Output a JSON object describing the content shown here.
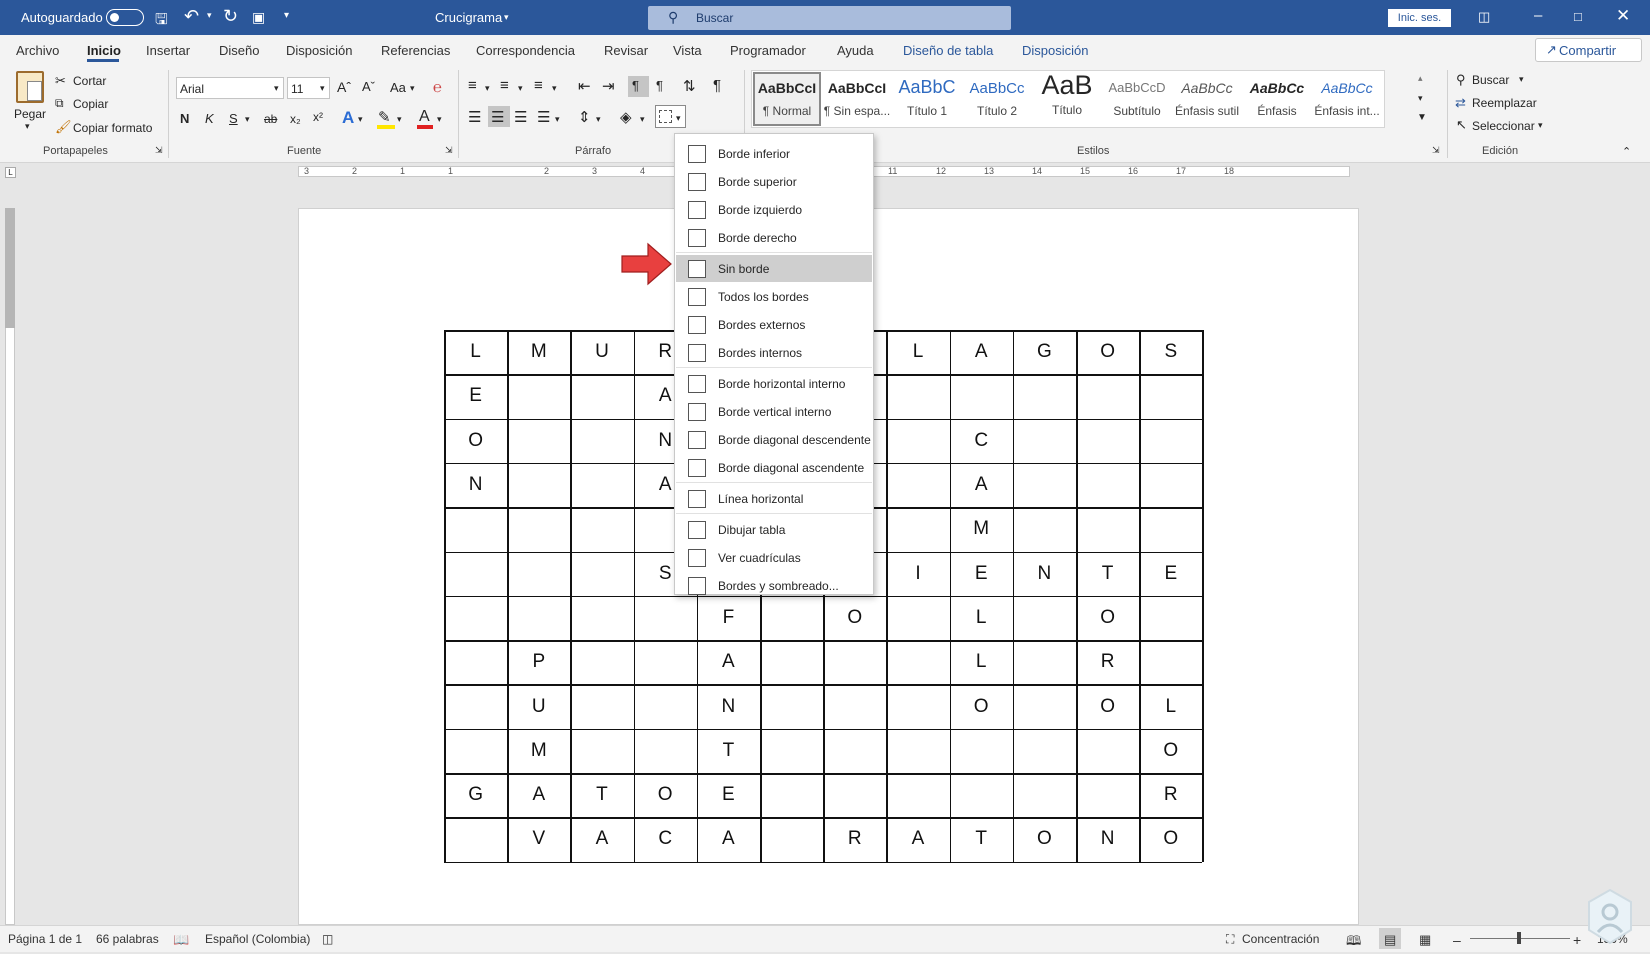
{
  "titlebar": {
    "autosave_label": "Autoguardado",
    "doc_name": "Crucigrama",
    "search_placeholder": "Buscar",
    "signin": "Inic. ses."
  },
  "tabs": [
    "Archivo",
    "Inicio",
    "Insertar",
    "Diseño",
    "Disposición",
    "Referencias",
    "Correspondencia",
    "Revisar",
    "Vista",
    "Programador",
    "Ayuda",
    "Diseño de tabla",
    "Disposición"
  ],
  "share": "Compartir",
  "clipboard": {
    "paste": "Pegar",
    "cut": "Cortar",
    "copy": "Copiar",
    "format_painter": "Copiar formato",
    "group": "Portapapeles"
  },
  "font": {
    "name": "Arial",
    "size": "11",
    "group": "Fuente",
    "bold": "N",
    "italic": "K",
    "underline": "S",
    "strike": "ab",
    "sub": "x₂",
    "sup": "x²",
    "case": "Aa"
  },
  "paragraph": {
    "group": "Párrafo"
  },
  "styles": {
    "group": "Estilos",
    "items": [
      {
        "preview": "AaBbCcI",
        "name": "¶ Normal"
      },
      {
        "preview": "AaBbCcI",
        "name": "¶ Sin espa..."
      },
      {
        "preview": "AaBbC",
        "name": "Título 1"
      },
      {
        "preview": "AaBbCc",
        "name": "Título 2"
      },
      {
        "preview": "AaB",
        "name": "Título"
      },
      {
        "preview": "AaBbCcD",
        "name": "Subtítulo"
      },
      {
        "preview": "AaBbCc",
        "name": "Énfasis sutil"
      },
      {
        "preview": "AaBbCc",
        "name": "Énfasis"
      },
      {
        "preview": "AaBbCc",
        "name": "Énfasis int..."
      }
    ]
  },
  "editing": {
    "find": "Buscar",
    "replace": "Reemplazar",
    "select": "Seleccionar",
    "group": "Edición"
  },
  "borders_menu": {
    "items": [
      {
        "label": "Borde inferior",
        "icon": "border-bottom-icon"
      },
      {
        "label": "Borde superior",
        "icon": "border-top-icon"
      },
      {
        "label": "Borde izquierdo",
        "icon": "border-left-icon"
      },
      {
        "label": "Borde derecho",
        "icon": "border-right-icon"
      },
      {
        "label": "Sin borde",
        "icon": "no-border-icon"
      },
      {
        "label": "Todos los bordes",
        "icon": "all-borders-icon"
      },
      {
        "label": "Bordes externos",
        "icon": "outside-borders-icon"
      },
      {
        "label": "Bordes internos",
        "icon": "inside-borders-icon"
      },
      {
        "label": "Borde horizontal interno",
        "icon": "inside-horizontal-border-icon"
      },
      {
        "label": "Borde vertical interno",
        "icon": "inside-vertical-border-icon"
      },
      {
        "label": "Borde diagonal descendente",
        "icon": "diagonal-down-border-icon"
      },
      {
        "label": "Borde diagonal ascendente",
        "icon": "diagonal-up-border-icon"
      },
      {
        "label": "Línea horizontal",
        "icon": "horizontal-line-icon"
      },
      {
        "label": "Dibujar tabla",
        "icon": "draw-table-icon"
      },
      {
        "label": "Ver cuadrículas",
        "icon": "view-gridlines-icon"
      },
      {
        "label": "Bordes y sombreado...",
        "icon": "borders-shading-icon"
      }
    ],
    "highlighted": "Sin borde"
  },
  "crossword": {
    "rows": [
      [
        "L",
        "M",
        "U",
        "R",
        "",
        "",
        "",
        "L",
        "A",
        "G",
        "O",
        "S"
      ],
      [
        "E",
        "",
        "",
        "A",
        "",
        "",
        "",
        "",
        "",
        "",
        "",
        ""
      ],
      [
        "O",
        "",
        "",
        "N",
        "",
        "",
        "",
        "",
        "C",
        "",
        "",
        ""
      ],
      [
        "N",
        "",
        "",
        "A",
        "",
        "",
        "",
        "",
        "A",
        "",
        "",
        ""
      ],
      [
        "",
        "",
        "",
        "",
        "",
        "",
        "",
        "",
        "M",
        "",
        "",
        ""
      ],
      [
        "",
        "",
        "",
        "S",
        "",
        "",
        "",
        "I",
        "E",
        "N",
        "T",
        "E"
      ],
      [
        "",
        "",
        "",
        "",
        "F",
        "",
        "O",
        "",
        "L",
        "",
        "O",
        ""
      ],
      [
        "",
        "P",
        "",
        "",
        "A",
        "",
        "",
        "",
        "L",
        "",
        "R",
        ""
      ],
      [
        "",
        "U",
        "",
        "",
        "N",
        "",
        "",
        "",
        "O",
        "",
        "O",
        "L"
      ],
      [
        "",
        "M",
        "",
        "",
        "T",
        "",
        "",
        "",
        "",
        "",
        "",
        "O"
      ],
      [
        "G",
        "A",
        "T",
        "O",
        "E",
        "",
        "",
        "",
        "",
        "",
        "",
        "R"
      ],
      [
        "",
        "V",
        "A",
        "C",
        "A",
        "",
        "R",
        "A",
        "T",
        "O",
        "N",
        "O"
      ]
    ]
  },
  "ruler_top": [
    "3",
    "2",
    "1",
    "1",
    "2",
    "3",
    "4",
    "11",
    "12",
    "13",
    "14",
    "15",
    "16",
    "17",
    "18"
  ],
  "status": {
    "page": "Página 1 de 1",
    "words": "66 palabras",
    "language": "Español (Colombia)",
    "focus": "Concentración",
    "zoom": "130%"
  },
  "colors": {
    "word_blue": "#2b579a",
    "arrow_red": "#e8403f",
    "contextual_tab": "#2b579a"
  }
}
